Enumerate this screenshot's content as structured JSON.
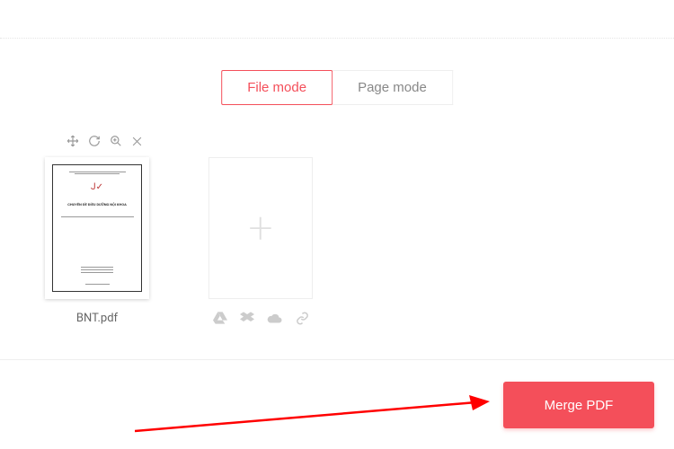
{
  "tabs": {
    "file_mode": "File mode",
    "page_mode": "Page mode"
  },
  "file": {
    "name": "BNT.pdf",
    "preview_title": "CHUYÊN ĐỀ ĐIỀU DƯỠNG NỘI KHOA"
  },
  "toolbar_icons": {
    "move": "move-icon",
    "rotate": "rotate-icon",
    "zoom": "zoom-in-icon",
    "remove": "close-icon"
  },
  "add_sources": {
    "gdrive": "google-drive-icon",
    "dropbox": "dropbox-icon",
    "onedrive": "onedrive-icon",
    "link": "link-icon"
  },
  "action": {
    "merge_label": "Merge PDF"
  },
  "colors": {
    "accent": "#f44f5a"
  }
}
